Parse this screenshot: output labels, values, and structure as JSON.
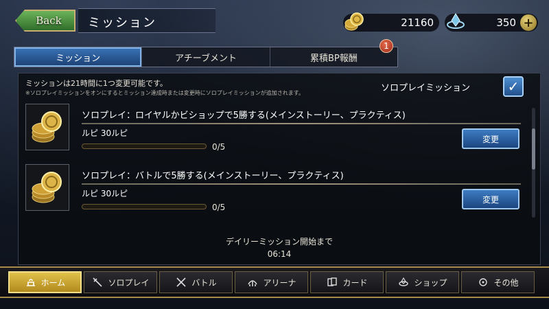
{
  "header": {
    "back_label": "Back",
    "title": "ミッション"
  },
  "currency": {
    "gold": "21160",
    "crystals": "350",
    "plus_label": "+"
  },
  "tabs": [
    {
      "label": "ミッション",
      "active": true
    },
    {
      "label": "アチーブメント",
      "active": false
    },
    {
      "label": "累積BP報酬",
      "active": false,
      "badge": "1"
    }
  ],
  "panel": {
    "info_line1": "ミッションは21時間に1つ変更可能です。",
    "info_line2": "※ソロプレイミッションをオンにするとミッション達成時または変更時にソロプレイミッションが追加されます。",
    "solo_toggle_label": "ソロプレイミッション",
    "solo_toggle_checked": true
  },
  "missions": [
    {
      "title": "ソロプレイ：ロイヤルかビショップで5勝する(メインストーリー、プラクティス)",
      "reward": "ルピ 30ルピ",
      "progress": "0/5",
      "progress_fraction": 0,
      "change_label": "変更"
    },
    {
      "title": "ソロプレイ：バトルで5勝する(メインストーリー、プラクティス)",
      "reward": "ルピ 30ルピ",
      "progress": "0/5",
      "progress_fraction": 0,
      "change_label": "変更"
    }
  ],
  "daily": {
    "label": "デイリーミッション開始まで",
    "time": "06:14"
  },
  "nav": [
    {
      "label": "ホーム",
      "icon": "home-icon",
      "active": true
    },
    {
      "label": "ソロプレイ",
      "icon": "swords-icon",
      "active": false
    },
    {
      "label": "バトル",
      "icon": "crossed-swords-icon",
      "active": false
    },
    {
      "label": "アリーナ",
      "icon": "arena-icon",
      "active": false
    },
    {
      "label": "カード",
      "icon": "cards-icon",
      "active": false
    },
    {
      "label": "ショップ",
      "icon": "shop-icon",
      "active": false
    },
    {
      "label": "その他",
      "icon": "other-icon",
      "active": false
    }
  ],
  "colors": {
    "accent_blue": "#2f66a8",
    "gold": "#d9b54a",
    "back_green": "#4c8f3e"
  }
}
